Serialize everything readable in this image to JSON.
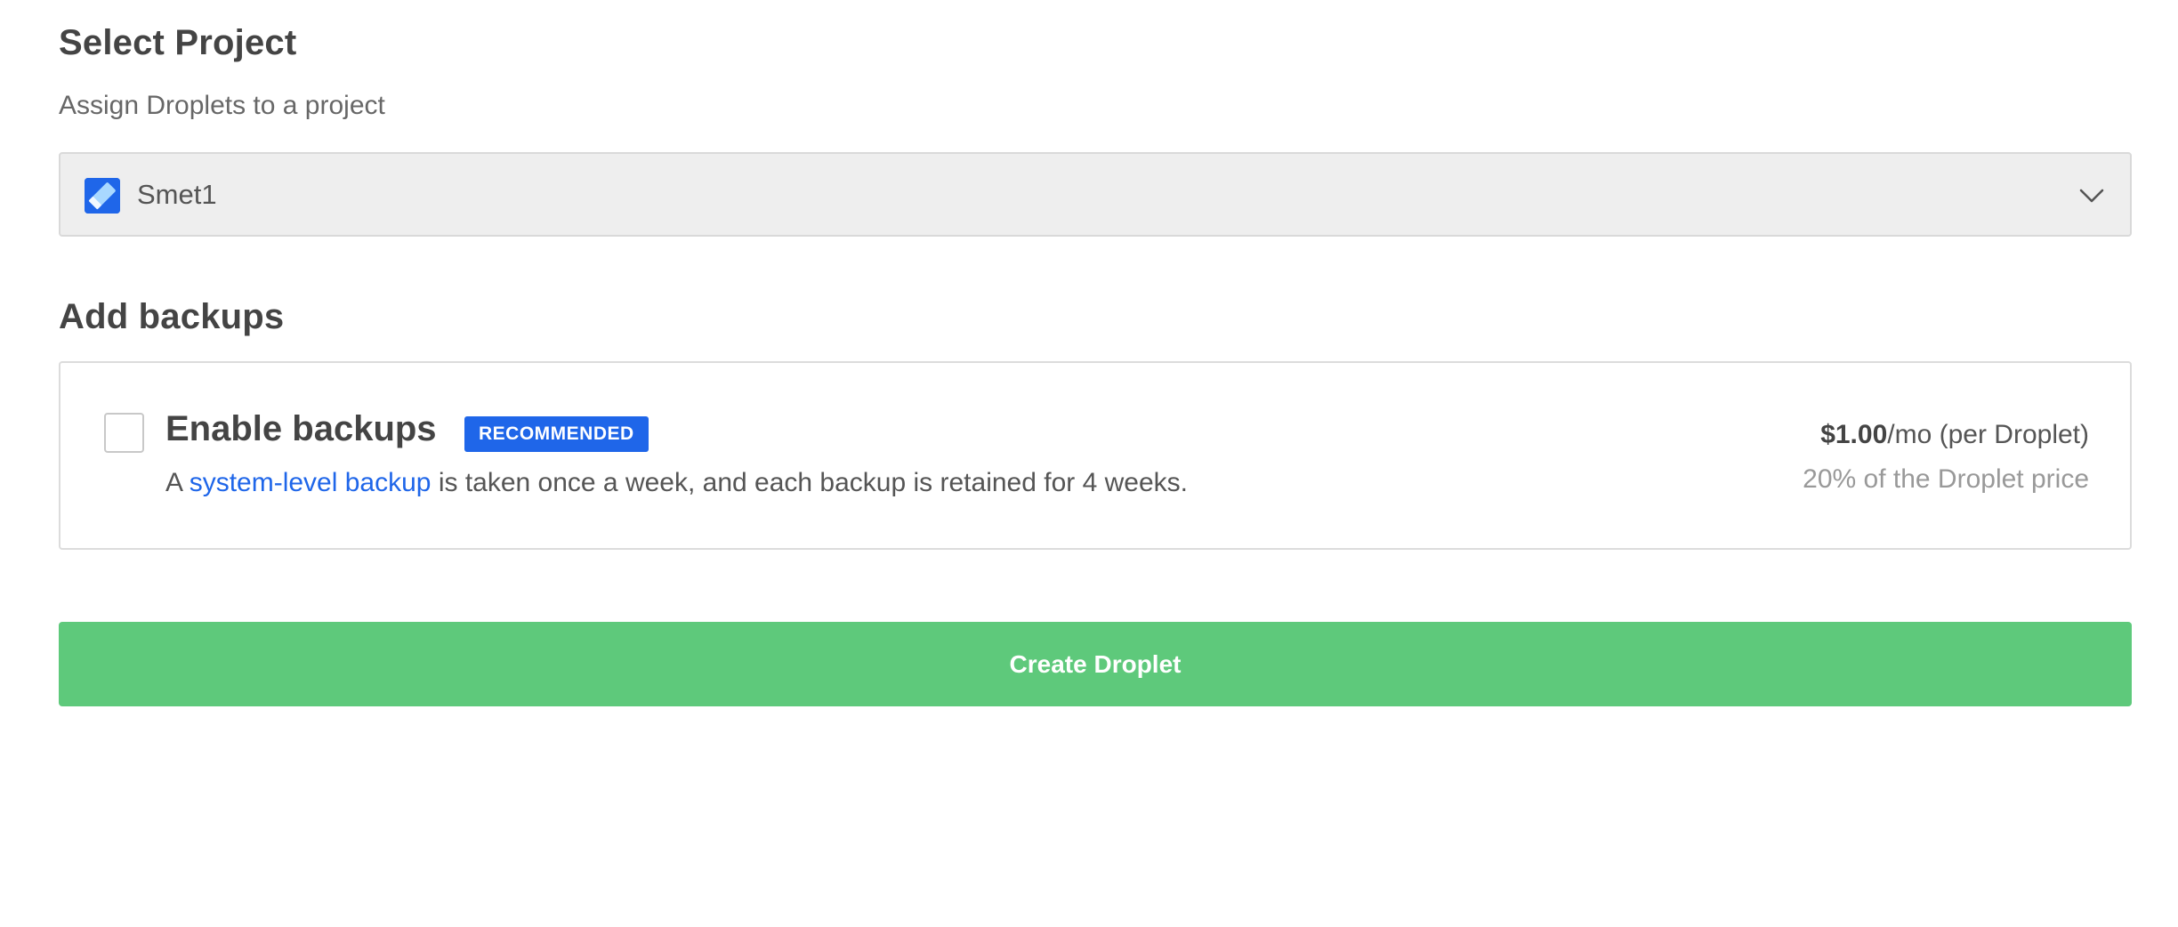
{
  "project_section": {
    "title": "Select Project",
    "subtitle": "Assign Droplets to a project",
    "selected_project": "Smet1",
    "icon": "project-pencil-icon",
    "dropdown_icon": "chevron-down-icon"
  },
  "backups_section": {
    "title": "Add backups",
    "option": {
      "label": "Enable backups",
      "checked": false,
      "badge": "RECOMMENDED",
      "description_prefix": "A ",
      "description_link": "system-level backup",
      "description_suffix": " is taken once a week, and each backup is retained for 4 weeks.",
      "price_amount": "$1.00",
      "price_unit": "/mo (per Droplet)",
      "price_note": "20% of the Droplet price"
    }
  },
  "actions": {
    "create_label": "Create Droplet"
  },
  "colors": {
    "accent_blue": "#1f66e9",
    "create_green": "#5ec97b",
    "select_bg": "#eeeeee"
  }
}
